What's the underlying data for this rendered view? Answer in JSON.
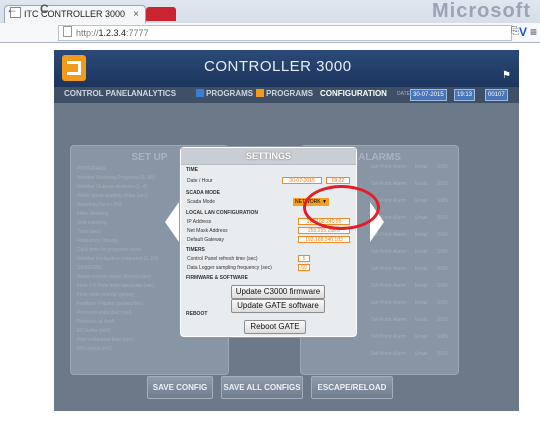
{
  "browser": {
    "tab_title": "ITC CONTROLLER 3000",
    "tab_close": "×",
    "brand": "Microsoft",
    "back": "←",
    "forward": "→",
    "reload": "C",
    "url_prefix": "http://",
    "url_host": "1.2.3.4",
    "url_port": ":7777",
    "menu": "≡"
  },
  "app": {
    "title": "CONTROLLER 3000",
    "tabs": [
      "CONTROL PANEL",
      "ANALYTICS",
      "PROGRAMS",
      "PROGRAMS",
      "CONFIGURATION"
    ],
    "active_tab": "CONFIGURATION",
    "date_label": "DATE",
    "date": "30-07-2015",
    "time": "19:13",
    "extra": "00107"
  },
  "panels": {
    "setup_title": "SET UP",
    "alarms_title": "ALARMS",
    "setup_lines": [
      "PROGRAMS",
      "Number Watering Programs (1..50)",
      "Number Outputs modules (1..4)",
      "Water pump starting delay (sec)",
      "Watering Factor (%)",
      "Filter cleaning",
      "Grid watering",
      "Time (sec)",
      "Frequency (hours)",
      "Daily time for programs reset",
      "Number Fertigation programs (1..50)",
      "SENSORS",
      "Water counter factor (liters/pulse)",
      "Flow > 5 Time from last pulse (sec)",
      "Flow units (metric/ gallon)",
      "Fertilizer V-factor (pulses/liter)",
      "Pressure units (bar / psi)",
      "Pressure at 4mA",
      "EC buffer (mV)",
      "Prm calibration time (sec)",
      "PH control (mV)"
    ],
    "alarm_lines": [
      "Set Point",
      "Alarm",
      "Email",
      "SMS"
    ]
  },
  "dialog": {
    "title": "SETTINGS",
    "time_section": "TIME",
    "date_hour_label": "Date / Hour",
    "date_value": "30-07-2015",
    "hour_value": "09:22",
    "scada_section": "SCADA MODE",
    "scada_label": "Scada Mode",
    "scada_value": "NETWORK ▼",
    "lan_section": "LOCAL LAN CONFIGURATION",
    "ip_label": "IP Address",
    "ip_value": "192.168.240.95",
    "mask_label": "Net Mask Address",
    "mask_value": "255.255.255.0",
    "gateway_label": "Default Gateway",
    "gateway_value": "192.168.240.183",
    "timers_section": "TIMERS",
    "refresh_label": "Control Panel refresh time (sec)",
    "refresh_value": "5",
    "logger_label": "Data Logger sampling frequency (sec)",
    "logger_value": "60",
    "firmware_section": "FIRMWARE & SOFTWARE",
    "update_fw": "Update C3000 firmware",
    "update_gate": "Update GATE software",
    "reboot_section": "REBOOT",
    "reboot_gate": "Reboot GATE"
  },
  "footer": {
    "save_config": "SAVE CONFIG",
    "save_all": "SAVE ALL CONFIGS",
    "escape": "ESCAPE/RELOAD"
  },
  "colors": {
    "header": "#1b355d",
    "accent": "#f29a1b",
    "highlight": "#e21e28"
  },
  "icons": [
    "back-icon",
    "forward-icon",
    "reload-icon",
    "page-icon",
    "menu-icon",
    "flag-icon",
    "chevron-left-icon",
    "chevron-right-icon"
  ]
}
